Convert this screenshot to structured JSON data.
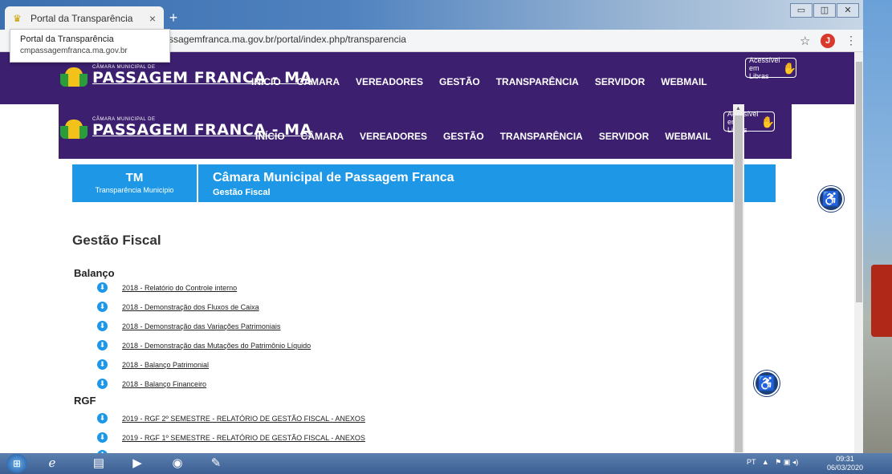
{
  "browser": {
    "tab_title": "Portal da Transparência",
    "tab_close": "×",
    "new_tab": "+",
    "url": "ssagemfranca.ma.gov.br/portal/index.php/transparencia",
    "avatar_letter": "J",
    "tooltip_title": "Portal da Transparência",
    "tooltip_host": "cmpassagemfranca.ma.gov.br"
  },
  "site": {
    "logo_small": "CÂMARA MUNICIPAL DE",
    "logo_big": "PASSAGEM FRANCA - MA",
    "menu": [
      "INÍCIO",
      "CÂMARA",
      "VEREADORES",
      "GESTÃO",
      "TRANSPARÊNCIA",
      "SERVIDOR",
      "WEBMAIL"
    ],
    "libras_line1": "Acessível",
    "libras_line2": "em Libras"
  },
  "banner": {
    "tm": "TM",
    "tm_sub": "Transparência Municipio",
    "title": "Câmara Municipal de Passagem Franca",
    "subtitle": "Gestão Fiscal"
  },
  "content": {
    "heading": "Gestão Fiscal",
    "sections": [
      {
        "title": "Balanço",
        "items": [
          "2018 - Relatório do Controle interno",
          "2018 - Demonstração dos Fluxos de Caixa",
          "2018 - Demonstração das Variações Patrimoniais",
          "2018 - Demonstração das Mutações do Patrimônio Líquido",
          "2018 - Balanço Patrimonial",
          "2018 - Balanço Financeiro"
        ]
      },
      {
        "title": "RGF",
        "items": [
          "2019 - RGF 2º SEMESTRE - RELATÓRIO DE GESTÃO FISCAL - ANEXOS",
          "2019 - RGF 1º SEMESTRE - RELATÓRIO DE GESTÃO FISCAL - ANEXOS"
        ]
      }
    ]
  },
  "taskbar": {
    "lang": "PT",
    "time": "09:31",
    "date": "06/03/2020"
  }
}
